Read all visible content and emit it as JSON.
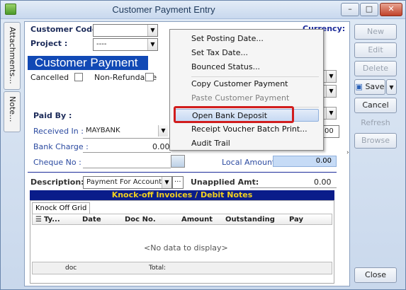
{
  "window": {
    "title": "Customer Payment Entry",
    "min": "–",
    "max": "□",
    "close": "✕"
  },
  "side_tabs": [
    "Attachments...",
    "Note..."
  ],
  "form": {
    "customer_code_label": "Customer Code:",
    "project_label": "Project :",
    "project_value": "----",
    "currency_label": "Currency:",
    "banner": "Customer Payment",
    "cancelled_label": "Cancelled",
    "non_refundable_label": "Non-Refundable",
    "paid_by_label": "Paid By :",
    "received_in_label": "Received In :",
    "received_in_value": "MAYBANK",
    "bank_charge_label": "Bank Charge :",
    "bank_charge_value": "0.00",
    "cheque_no_label": "Cheque No :",
    "local_amount_label": "Local Amount :",
    "local_amount_value": "0.00",
    "partial_value": "00",
    "description_label": "Description:",
    "description_value": "Payment For Account",
    "unapplied_label": "Unapplied Amt:",
    "unapplied_value": "0.00"
  },
  "knockoff": {
    "title": "Knock-off Invoices / Debit Notes",
    "tab": "Knock Off Grid",
    "columns": [
      "Ty...",
      "Date",
      "Doc No.",
      "Amount",
      "Outstanding",
      "Pay"
    ],
    "empty": "<No data to display>",
    "footer_doc": "doc",
    "footer_total": "Total:"
  },
  "context_menu": {
    "items": [
      {
        "label": "Set Posting Date...",
        "disabled": false
      },
      {
        "label": "Set Tax Date...",
        "disabled": false
      },
      {
        "label": "Bounced Status...",
        "disabled": false
      },
      {
        "label": "Copy Customer Payment",
        "disabled": false
      },
      {
        "label": "Paste Customer Payment",
        "disabled": true
      },
      {
        "label": "Open Bank Deposit",
        "disabled": false
      },
      {
        "label": "Receipt Voucher Batch Print...",
        "disabled": false
      },
      {
        "label": "Audit Trail",
        "disabled": false
      }
    ]
  },
  "right_buttons": {
    "new": "New",
    "edit": "Edit",
    "delete": "Delete",
    "save": "Save",
    "cancel": "Cancel",
    "refresh": "Refresh",
    "browse": "Browse",
    "close": "Close"
  }
}
